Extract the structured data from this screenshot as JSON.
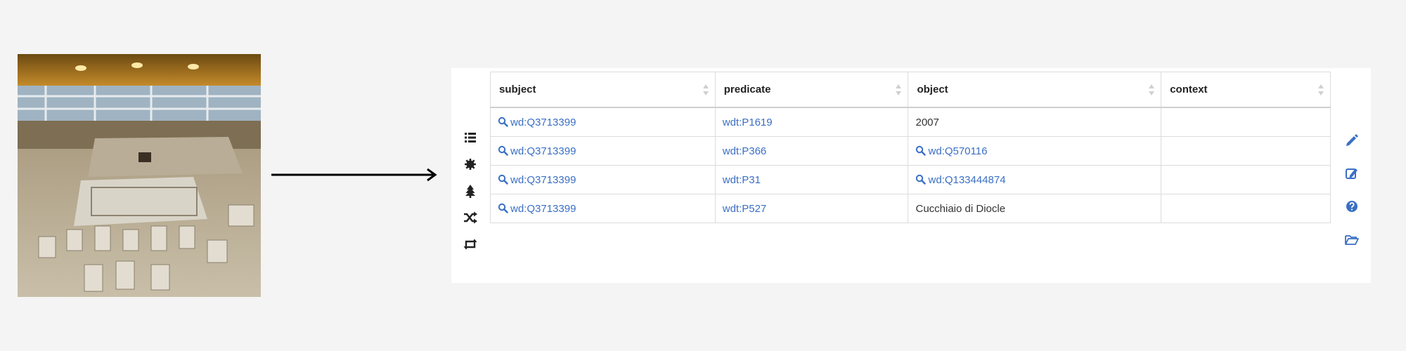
{
  "image": {
    "alt": "excavated Roman villa mosaic floor under protective roof",
    "icon": "photo"
  },
  "arrow": {
    "icon": "right-arrow-icon"
  },
  "colors": {
    "link": "#3a6fc4",
    "panel_bg": "#ffffff",
    "page_bg": "#f4f4f4"
  },
  "left_toolbar": [
    {
      "icon": "list-icon"
    },
    {
      "icon": "gear-icon"
    },
    {
      "icon": "tree-icon"
    },
    {
      "icon": "shuffle-icon"
    },
    {
      "icon": "retweet-icon"
    }
  ],
  "right_toolbar": [
    {
      "icon": "pencil-icon"
    },
    {
      "icon": "edit-square-icon"
    },
    {
      "icon": "help-icon"
    },
    {
      "icon": "folder-open-icon"
    }
  ],
  "table": {
    "columns": [
      "subject",
      "predicate",
      "object",
      "context"
    ],
    "rows": [
      {
        "subject": "wd:Q3713399",
        "predicate": "wdt:P1619",
        "object": "2007",
        "object_is_link": false,
        "context": ""
      },
      {
        "subject": "wd:Q3713399",
        "predicate": "wdt:P366",
        "object": "wd:Q570116",
        "object_is_link": true,
        "context": ""
      },
      {
        "subject": "wd:Q3713399",
        "predicate": "wdt:P31",
        "object": "wd:Q133444874",
        "object_is_link": true,
        "context": ""
      },
      {
        "subject": "wd:Q3713399",
        "predicate": "wdt:P527",
        "object": "Cucchiaio di Diocle",
        "object_is_link": false,
        "context": ""
      }
    ]
  }
}
